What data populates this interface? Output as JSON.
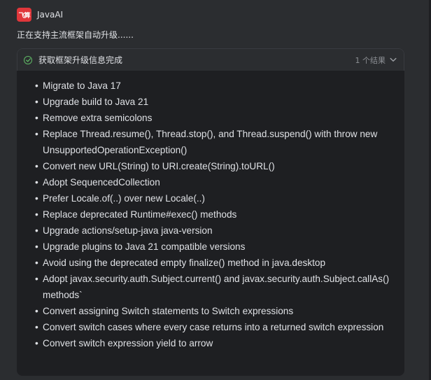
{
  "app": {
    "name": "JavaAI",
    "logo_text": "飞算",
    "logo_color": "#e0373b"
  },
  "status_line": "正在支持主流框架自动升级......",
  "card": {
    "title": "获取框架升级信息完成",
    "result_count": "1 个结果",
    "status_icon": "check-circle-icon",
    "status_color": "#5fb865",
    "toggle_icon": "chevron-down-icon",
    "items": [
      "Migrate to Java 17",
      "Upgrade build to Java 21",
      "Remove extra semicolons",
      "Replace Thread.resume(), Thread.stop(), and Thread.suspend() with throw new UnsupportedOperationException()",
      "Convert new URL(String) to URI.create(String).toURL()",
      "Adopt SequencedCollection",
      "Prefer Locale.of(..) over new Locale(..)",
      "Replace deprecated Runtime#exec() methods",
      "Upgrade actions/setup-java java-version",
      "Upgrade plugins to Java 21 compatible versions",
      "Avoid using the deprecated empty finalize() method in java.desktop",
      "Adopt javax.security.auth.Subject.current() and javax.security.auth.Subject.callAs() methods`",
      "Convert assigning Switch statements to Switch expressions",
      "Convert switch cases where every case returns into a returned switch expression",
      "Convert switch expression yield to arrow"
    ]
  }
}
